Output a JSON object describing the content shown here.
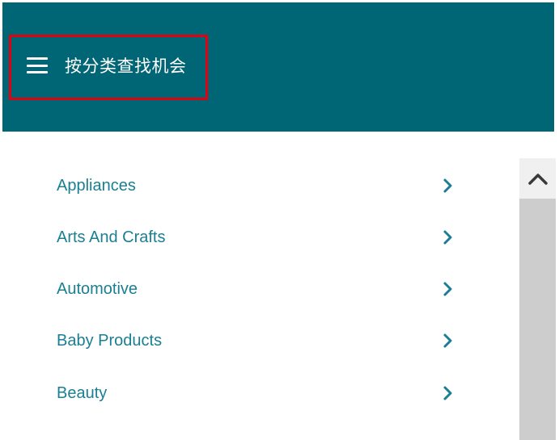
{
  "header": {
    "title": "按分类查找机会",
    "menu_icon": "hamburger-menu-icon",
    "background_color": "#006574",
    "highlight_color": "#e3000f"
  },
  "categories": [
    {
      "label": "Appliances",
      "icon": "chevron-right-icon"
    },
    {
      "label": "Arts And Crafts",
      "icon": "chevron-right-icon"
    },
    {
      "label": "Automotive",
      "icon": "chevron-right-icon"
    },
    {
      "label": "Baby Products",
      "icon": "chevron-right-icon"
    },
    {
      "label": "Beauty",
      "icon": "chevron-right-icon"
    }
  ],
  "colors": {
    "link": "#1a7f92",
    "scrollbar_track": "#cdcdcd",
    "scrollbar_button": "#f0f0f0"
  }
}
